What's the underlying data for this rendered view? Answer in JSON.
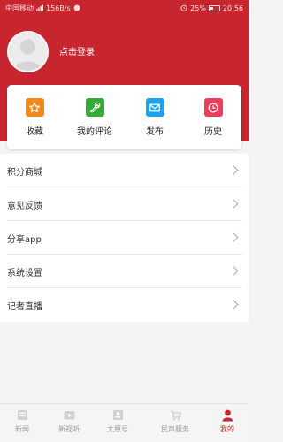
{
  "status_bar": {
    "carrier": "中国移动",
    "speed": "156B/s",
    "battery": "25%",
    "time": "20:56",
    "icons": [
      "signal-icon",
      "chat-icon",
      "alarm-icon",
      "battery-icon"
    ]
  },
  "profile": {
    "login_label": "点击登录"
  },
  "quick_actions": [
    {
      "label": "收藏",
      "icon": "star-icon",
      "color": "#f18a19"
    },
    {
      "label": "我的评论",
      "icon": "comment-icon",
      "color": "#33ab36"
    },
    {
      "label": "发布",
      "icon": "mail-icon",
      "color": "#1ba2e8"
    },
    {
      "label": "历史",
      "icon": "history-icon",
      "color": "#ea3f5a"
    }
  ],
  "menu": [
    {
      "label": "积分商城"
    },
    {
      "label": "意见反馈"
    },
    {
      "label": "分享app"
    },
    {
      "label": "系统设置"
    },
    {
      "label": "记者直播"
    }
  ],
  "tabs": [
    {
      "label": "新闻",
      "icon": "news-icon"
    },
    {
      "label": "新视听",
      "icon": "video-icon"
    },
    {
      "label": "太原号",
      "icon": "account-icon"
    },
    {
      "label": "民声服务",
      "icon": "service-icon"
    },
    {
      "label": "我的",
      "icon": "profile-icon",
      "active": true
    }
  ],
  "colors": {
    "brand": "#c8262e",
    "background": "#f4f4f4",
    "card": "#ffffff"
  }
}
